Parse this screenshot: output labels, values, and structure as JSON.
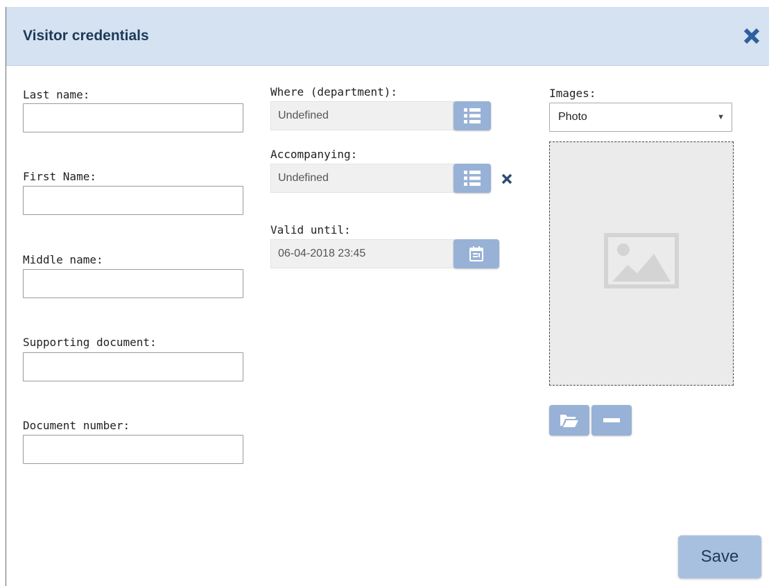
{
  "dialog": {
    "title": "Visitor credentials"
  },
  "form": {
    "last_name": {
      "label": "Last name:",
      "value": ""
    },
    "first_name": {
      "label": "First Name:",
      "value": ""
    },
    "middle_name": {
      "label": "Middle name:",
      "value": ""
    },
    "supporting_document": {
      "label": "Supporting document:",
      "value": ""
    },
    "document_number": {
      "label": "Document number:",
      "value": ""
    },
    "department": {
      "label": "Where (department):",
      "value": "Undefined"
    },
    "accompanying": {
      "label": "Accompanying:",
      "value": "Undefined"
    },
    "valid_until": {
      "label": "Valid until:",
      "value": "06-04-2018 23:45"
    }
  },
  "images": {
    "label": "Images:",
    "selected": "Photo"
  },
  "actions": {
    "save_label": "Save"
  },
  "colors": {
    "header_bg": "#d4e2f2",
    "accent": "#98b1d6",
    "title": "#1e3957"
  },
  "icons": [
    "close-icon",
    "list-icon",
    "calendar-icon",
    "image-placeholder-icon",
    "folder-open-icon",
    "minus-icon"
  ]
}
